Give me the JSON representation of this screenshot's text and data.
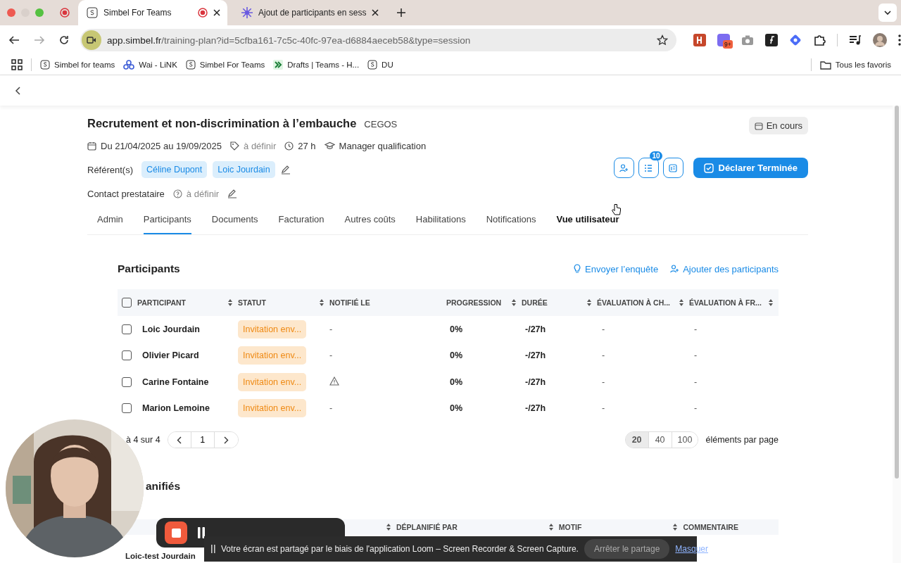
{
  "browser": {
    "tabs": [
      {
        "title": "Simbel For Teams",
        "selected": true,
        "recording": true
      },
      {
        "title": "Ajout de participants en sess",
        "selected": false,
        "recording": false
      }
    ],
    "url_host": "app.simbel.fr",
    "url_path": "/training-plan?id=5cfba161-7c5c-40fc-97ea-d6884aeceb58&type=session",
    "extension_badge": "9+",
    "bookmarks": [
      {
        "label": "Simbel for teams",
        "kind": "s"
      },
      {
        "label": "Wai - LiNK",
        "kind": "rings"
      },
      {
        "label": "Simbel For Teams",
        "kind": "s"
      },
      {
        "label": "Drafts | Teams - H...",
        "kind": "drafts"
      },
      {
        "label": "DU",
        "kind": "s"
      }
    ],
    "favorites": "Tous les favoris"
  },
  "page": {
    "title": "Recrutement et non-discrimination à l’embauche",
    "provider": "CEGOS",
    "status": "En cours",
    "dates": "Du 21/04/2025 au 19/09/2025",
    "price": "à définir",
    "duration": "27 h",
    "category": "Manager qualification",
    "referents_label": "Référent(s)",
    "referents": [
      "Céline Dupont",
      "Loic Jourdain"
    ],
    "contact_label": "Contact prestataire",
    "contact_value": "à définir",
    "list_badge": "10",
    "primary_button": "Déclarer Terminée",
    "tabs": [
      {
        "label": "Admin",
        "selected": false,
        "hovered": false
      },
      {
        "label": "Participants",
        "selected": true,
        "hovered": false
      },
      {
        "label": "Documents",
        "selected": false,
        "hovered": false
      },
      {
        "label": "Facturation",
        "selected": false,
        "hovered": false
      },
      {
        "label": "Autres coûts",
        "selected": false,
        "hovered": false
      },
      {
        "label": "Habilitations",
        "selected": false,
        "hovered": false
      },
      {
        "label": "Notifications",
        "selected": false,
        "hovered": false
      },
      {
        "label": "Vue utilisateur",
        "selected": false,
        "hovered": true
      }
    ],
    "select_all_checked": false,
    "section_title": "Participants",
    "survey_action": "Envoyer l’enquête",
    "add_action": "Ajouter des participants",
    "columns": [
      {
        "label": "PARTICIPANT",
        "sortable": true
      },
      {
        "label": "STATUT",
        "sortable": true
      },
      {
        "label": "NOTIFIÉ LE",
        "sortable": false
      },
      {
        "label": "PROGRESSION",
        "sortable": true
      },
      {
        "label": "DURÉE",
        "sortable": true
      },
      {
        "label": "ÉVALUATION À CH...",
        "sortable": true
      },
      {
        "label": "ÉVALUATION À FR...",
        "sortable": true
      }
    ],
    "rows": [
      {
        "checked": false,
        "name": "Loic Jourdain",
        "status": "Invitation env...",
        "notified": "-",
        "warning": false,
        "progression": "0%",
        "duration": "-/27h",
        "eval_hot": "-",
        "eval_cold": "-"
      },
      {
        "checked": false,
        "name": "Olivier Picard",
        "status": "Invitation env...",
        "notified": "-",
        "warning": false,
        "progression": "0%",
        "duration": "-/27h",
        "eval_hot": "-",
        "eval_cold": "-"
      },
      {
        "checked": false,
        "name": "Carine Fontaine",
        "status": "Invitation env...",
        "warning": true,
        "progression": "0%",
        "duration": "-/27h",
        "eval_hot": "-",
        "eval_cold": "-"
      },
      {
        "checked": false,
        "name": "Marion Lemoine",
        "status": "Invitation env...",
        "notified": "-",
        "warning": false,
        "progression": "0%",
        "duration": "-/27h",
        "eval_hot": "-",
        "eval_cold": "-"
      }
    ],
    "range": "à 4 sur 4",
    "current_page": "1",
    "page_sizes": [
      {
        "label": "20",
        "selected": true
      },
      {
        "label": "40",
        "selected": false
      },
      {
        "label": "100",
        "selected": false
      }
    ],
    "per_page_label": "éléments par page",
    "second_section_title": "anifiés",
    "second_columns": [
      "DÉPLANIFIÉ PAR",
      "MOTIF",
      "COMMENTAIRE"
    ],
    "second_rows": [
      {
        "name": "Loic-test Jourdain"
      }
    ]
  },
  "share_bar": {
    "message": "Votre écran est partagé par le biais de l'application Loom – Screen Recorder & Screen Capture.",
    "stop_button": "Arrêter le partage",
    "hide_link": "Masquer"
  }
}
